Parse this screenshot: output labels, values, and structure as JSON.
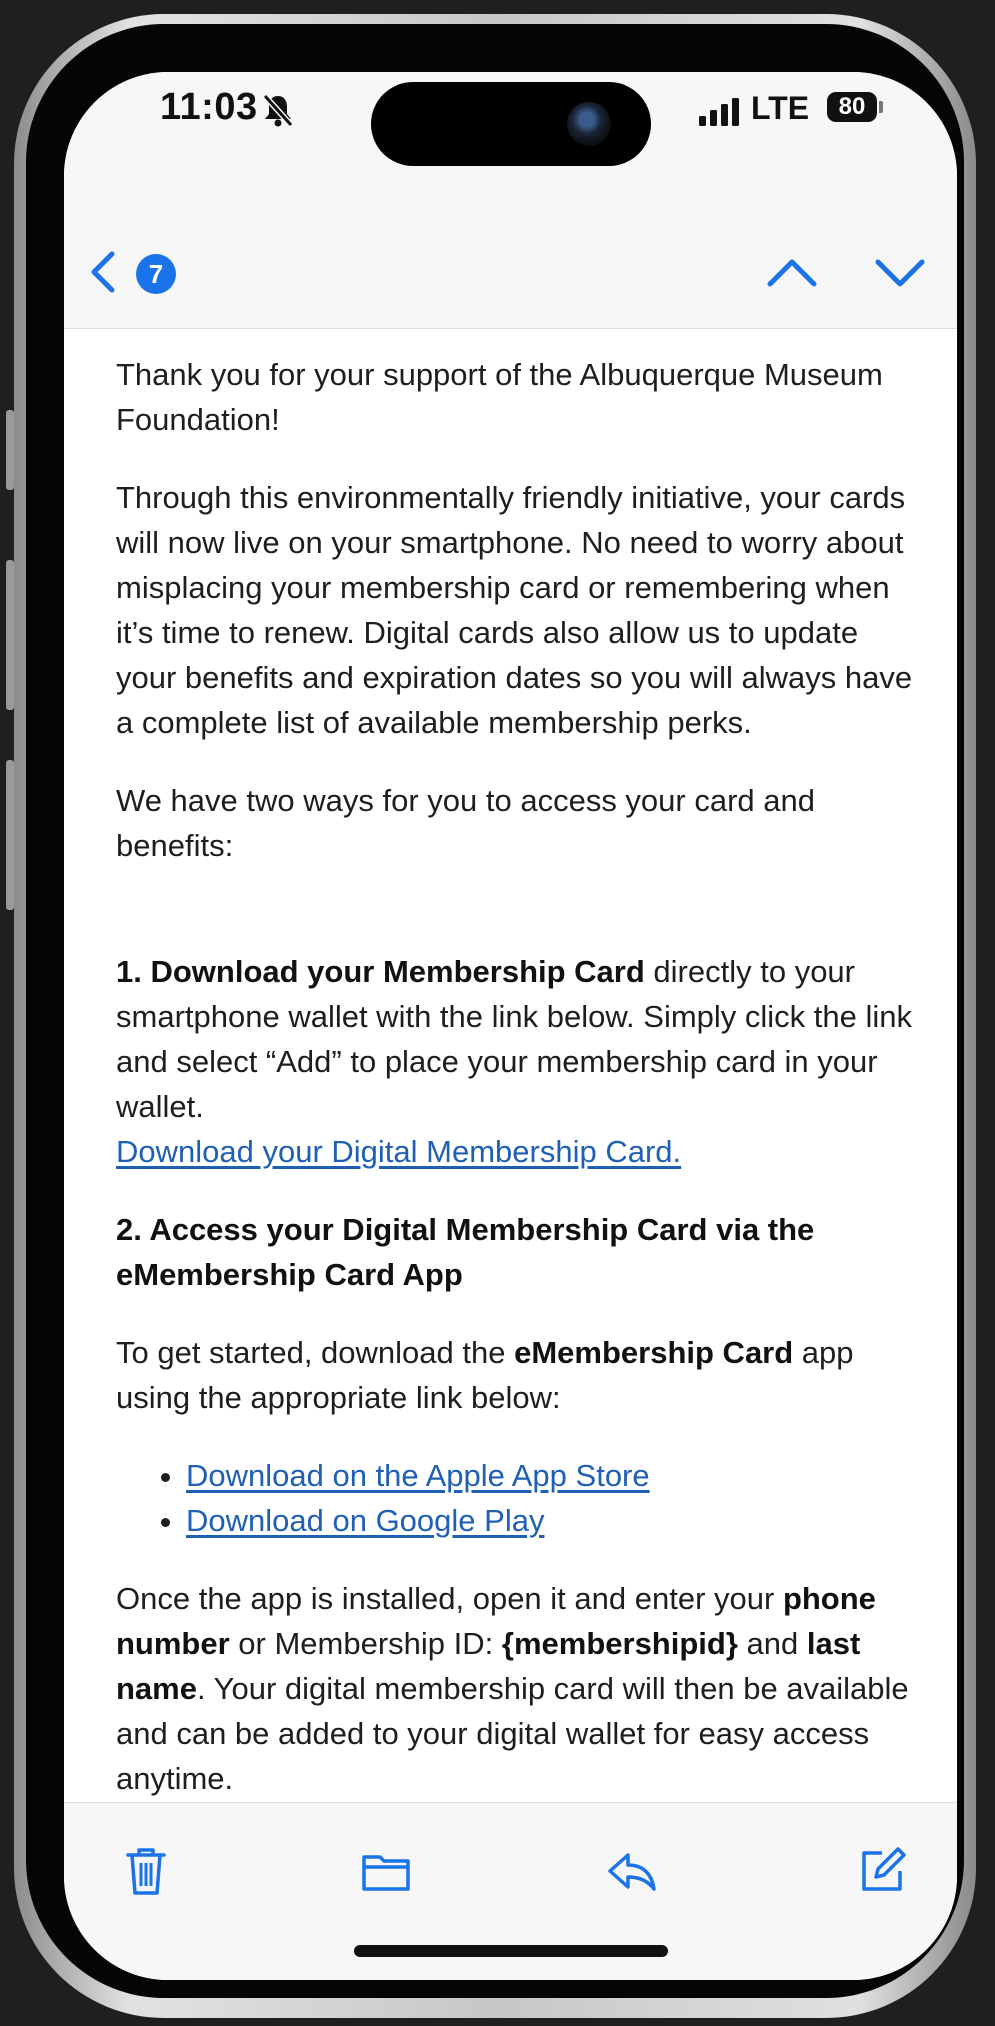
{
  "status_bar": {
    "time": "11:03",
    "network": "LTE",
    "battery": "80"
  },
  "nav": {
    "unread_count": "7"
  },
  "email": {
    "p1": "Thank you for your support of the Albuquerque Museum Foundation!",
    "p2": "Through this environmentally friendly initiative, your cards will now live on your smartphone. No need to worry about misplacing your membership card or remembering when it’s time to renew. Digital cards also allow us to update your benefits and expiration dates so you will always have a complete list of available membership perks.",
    "p3": "We have two ways for you to access your card and benefits:",
    "step1": {
      "bold": "1. Download your Membership Card",
      "text": " directly to your smartphone wallet with the link below. Simply click the link and select “Add” to place your membership card in your wallet.",
      "link": "Download your Digital Membership Card."
    },
    "step2_heading": "2. Access your Digital Membership Card via the eMembership Card App",
    "started": {
      "pre": "To get started, download the ",
      "bold": "eMembership Card",
      "post": " app using the appropriate link below:"
    },
    "links": {
      "apple": "Download on the Apple App Store",
      "google": "Download on Google Play"
    },
    "installed": {
      "t1": "Once the app is installed, open it and enter your ",
      "b1": "phone number",
      "t2": " or Membership ID: ",
      "b2": "{membershipid}",
      "t3": " and ",
      "b3": "last name",
      "t4": ". Your digital membership card will then be available and can be added to your digital wallet for easy access anytime."
    }
  },
  "colors": {
    "accent": "#1a73e8",
    "link": "#1f5fb4"
  },
  "icons": {
    "back": "chevron-left-icon",
    "prev": "chevron-up-icon",
    "next": "chevron-down-icon",
    "trash": "trash-icon",
    "folder": "folder-icon",
    "reply": "reply-icon",
    "compose": "compose-icon"
  }
}
